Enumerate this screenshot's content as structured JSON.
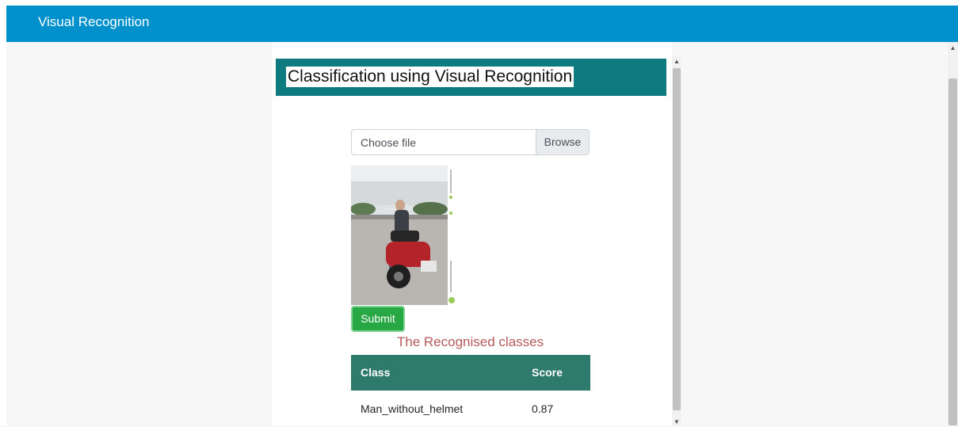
{
  "navbar": {
    "brand": "Visual Recognition"
  },
  "header": {
    "title": "Classification using Visual Recognition"
  },
  "file_input": {
    "label": "Choose file",
    "browse_label": "Browse"
  },
  "submit": {
    "label": "Submit"
  },
  "results": {
    "heading": "The Recognised classes",
    "columns": [
      "Class",
      "Score"
    ],
    "rows": [
      {
        "class": "Man_without_helmet",
        "score": "0.87"
      }
    ]
  },
  "colors": {
    "navbar": "#0090cc",
    "header_band": "#0e7b80",
    "table_header": "#2e7a6c",
    "submit": "#28a745",
    "result_heading": "#b75a5a"
  }
}
